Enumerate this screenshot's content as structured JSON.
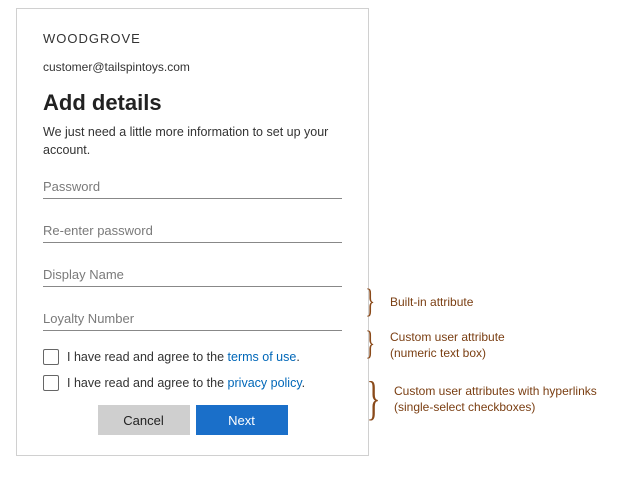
{
  "brand": "WOODGROVE",
  "email": "customer@tailspintoys.com",
  "title": "Add details",
  "subtitle": "We just need a little more information to set up your account.",
  "fields": {
    "password": "Password",
    "reenter": "Re-enter password",
    "display_name": "Display Name",
    "loyalty": "Loyalty Number"
  },
  "checks": {
    "terms_prefix": "I have read and agree to the ",
    "terms_link": "terms of use",
    "privacy_prefix": "I have read and agree to the ",
    "privacy_link": "privacy policy",
    "period": "."
  },
  "buttons": {
    "cancel": "Cancel",
    "next": "Next"
  },
  "annotations": {
    "builtin": "Built-in attribute",
    "custom_numeric_l1": "Custom user attribute",
    "custom_numeric_l2": "(numeric text box)",
    "custom_check_l1": "Custom user attributes with hyperlinks",
    "custom_check_l2": "(single-select checkboxes)"
  }
}
